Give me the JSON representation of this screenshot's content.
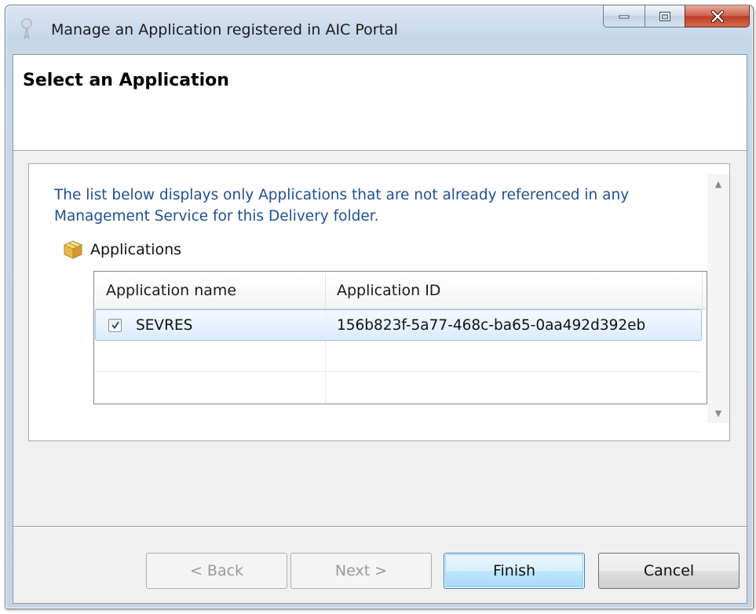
{
  "window": {
    "title": "Manage an Application registered in AIC Portal"
  },
  "header": {
    "title": "Select an Application"
  },
  "content": {
    "info_text": "The list below displays only Applications that are not already referenced in any Management Service for this Delivery folder.",
    "applications_label": "Applications",
    "applications_icon": "package-icon"
  },
  "grid": {
    "columns": [
      "Application name",
      "Application ID"
    ],
    "rows": [
      {
        "checked": true,
        "name": "SEVRES",
        "id": "156b823f-5a77-468c-ba65-0aa492d392eb"
      }
    ]
  },
  "buttons": {
    "back": "< Back",
    "next": "Next >",
    "finish": "Finish",
    "cancel": "Cancel"
  },
  "colors": {
    "info_text": "#1e4f94",
    "selection": "#dcebfc",
    "close_button": "#c7432c"
  }
}
